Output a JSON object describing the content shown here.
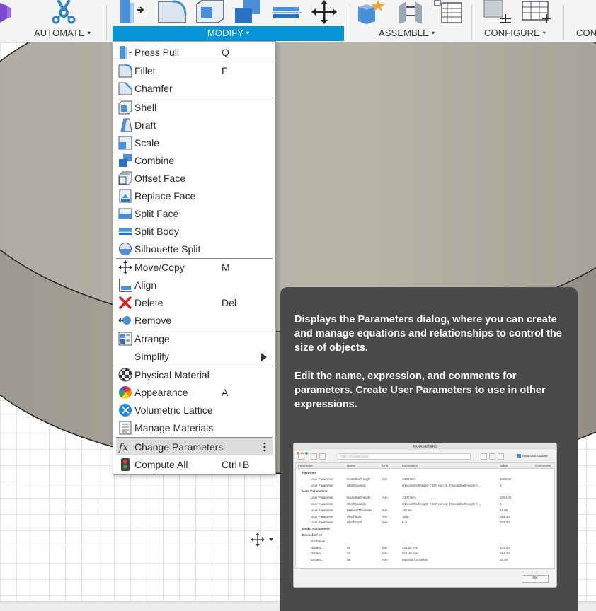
{
  "ribbon": {
    "groups": [
      {
        "label": "AUTOMATE"
      },
      {
        "label": "MODIFY"
      },
      {
        "label": "ASSEMBLE"
      },
      {
        "label": "CONFIGURE"
      },
      {
        "label": "CON"
      }
    ],
    "caret": "▾",
    "accent_color": "#0696d7"
  },
  "menu": {
    "items": [
      {
        "label": "Press Pull",
        "shortcut": "Q",
        "icon": "press-pull-icon"
      },
      {
        "label": "Fillet",
        "shortcut": "F",
        "icon": "fillet-icon"
      },
      {
        "label": "Chamfer",
        "shortcut": "",
        "icon": "chamfer-icon"
      },
      {
        "label": "Shell",
        "shortcut": "",
        "icon": "shell-icon"
      },
      {
        "label": "Draft",
        "shortcut": "",
        "icon": "draft-icon"
      },
      {
        "label": "Scale",
        "shortcut": "",
        "icon": "scale-icon"
      },
      {
        "label": "Combine",
        "shortcut": "",
        "icon": "combine-icon"
      },
      {
        "label": "Offset Face",
        "shortcut": "",
        "icon": "offset-face-icon"
      },
      {
        "label": "Replace Face",
        "shortcut": "",
        "icon": "replace-face-icon"
      },
      {
        "label": "Split Face",
        "shortcut": "",
        "icon": "split-face-icon"
      },
      {
        "label": "Split Body",
        "shortcut": "",
        "icon": "split-body-icon"
      },
      {
        "label": "Silhouette Split",
        "shortcut": "",
        "icon": "silhouette-split-icon"
      },
      {
        "label": "Move/Copy",
        "shortcut": "M",
        "icon": "move-copy-icon"
      },
      {
        "label": "Align",
        "shortcut": "",
        "icon": "align-icon"
      },
      {
        "label": "Delete",
        "shortcut": "Del",
        "icon": "delete-icon"
      },
      {
        "label": "Remove",
        "shortcut": "",
        "icon": "remove-icon"
      },
      {
        "label": "Arrange",
        "shortcut": "",
        "icon": "arrange-icon"
      },
      {
        "label": "Simplify",
        "shortcut": "",
        "icon": "simplify-submenu-arrow"
      },
      {
        "label": "Physical Material",
        "shortcut": "",
        "icon": "physical-material-icon"
      },
      {
        "label": "Appearance",
        "shortcut": "A",
        "icon": "appearance-icon"
      },
      {
        "label": "Volumetric Lattice",
        "shortcut": "",
        "icon": "volumetric-lattice-icon"
      },
      {
        "label": "Manage Materials",
        "shortcut": "",
        "icon": "manage-materials-icon"
      },
      {
        "label": "Change Parameters",
        "shortcut": "",
        "icon": "fx-icon"
      },
      {
        "label": "Compute All",
        "shortcut": "Ctrl+B",
        "icon": "compute-all-icon"
      }
    ],
    "highlighted": "Change Parameters"
  },
  "tooltip": {
    "paragraph1": "Displays the Parameters dialog, where you can create and manage equations and relationships to control the size of objects.",
    "paragraph2": "Edit the name, expression, and comments for parameters. Create User Parameters to use in other expressions.",
    "background_color": "#4a4a4a"
  },
  "preview": {
    "title": "PARAMETERS",
    "search_placeholder": "Filter all parameters",
    "auto_update": "Automatic Update",
    "columns": [
      "Parameter",
      "Name",
      "Unit",
      "Expression",
      "Value",
      "Comments"
    ],
    "rows": [
      {
        "group": true,
        "cells": [
          "Favorites",
          "",
          "",
          "",
          ""
        ]
      },
      {
        "group": false,
        "cells": [
          "User Parameter",
          "BookShelfHeight",
          "mm",
          "1000 mm",
          "1000.00"
        ]
      },
      {
        "group": false,
        "cells": [
          "User Parameter",
          "ShelfQuantity",
          "",
          "if(BookShelfHeight < 500 mm; 2; if(BookShelfHeight < ...",
          "3"
        ]
      },
      {
        "group": true,
        "cells": [
          "User Parameters",
          "",
          "",
          "",
          ""
        ]
      },
      {
        "group": false,
        "cells": [
          "User Parameter",
          "BookShelfHeight",
          "mm",
          "1000 mm",
          "1000.00"
        ]
      },
      {
        "group": false,
        "cells": [
          "User Parameter",
          "ShelfQuantity",
          "",
          "if(BookShelfHeight < 500 mm; 2; if(BookShelfHeight < ...",
          "3"
        ]
      },
      {
        "group": false,
        "cells": [
          "User Parameter",
          "MaterialThickness",
          "mm",
          "18 mm",
          "18.00"
        ]
      },
      {
        "group": false,
        "cells": [
          "User Parameter",
          "ShelfWidth",
          "mm",
          "36 in",
          "914.40"
        ]
      },
      {
        "group": false,
        "cells": [
          "User Parameter",
          "ShelfDepth",
          "mm",
          "8 in",
          "203.20"
        ]
      },
      {
        "group": true,
        "cells": [
          "Model Parameters",
          "",
          "",
          "",
          ""
        ]
      },
      {
        "group": true,
        "cells": [
          "Bookshelf v9",
          "",
          "",
          "",
          ""
        ]
      },
      {
        "group": false,
        "cells": [
          "BoxPrimiti...",
          "",
          "",
          "",
          ""
        ]
      },
      {
        "group": false,
        "cells": [
          "Distanc...",
          "d6",
          "mm",
          "203.20 mm",
          "203.20"
        ]
      },
      {
        "group": false,
        "cells": [
          "Distanc...",
          "d7",
          "mm",
          "914.40 mm",
          "914.40"
        ]
      },
      {
        "group": false,
        "cells": [
          "Distanc...",
          "d8",
          "mm",
          "MaterialThickness",
          "18.00"
        ]
      }
    ],
    "ok_label": "OK"
  }
}
